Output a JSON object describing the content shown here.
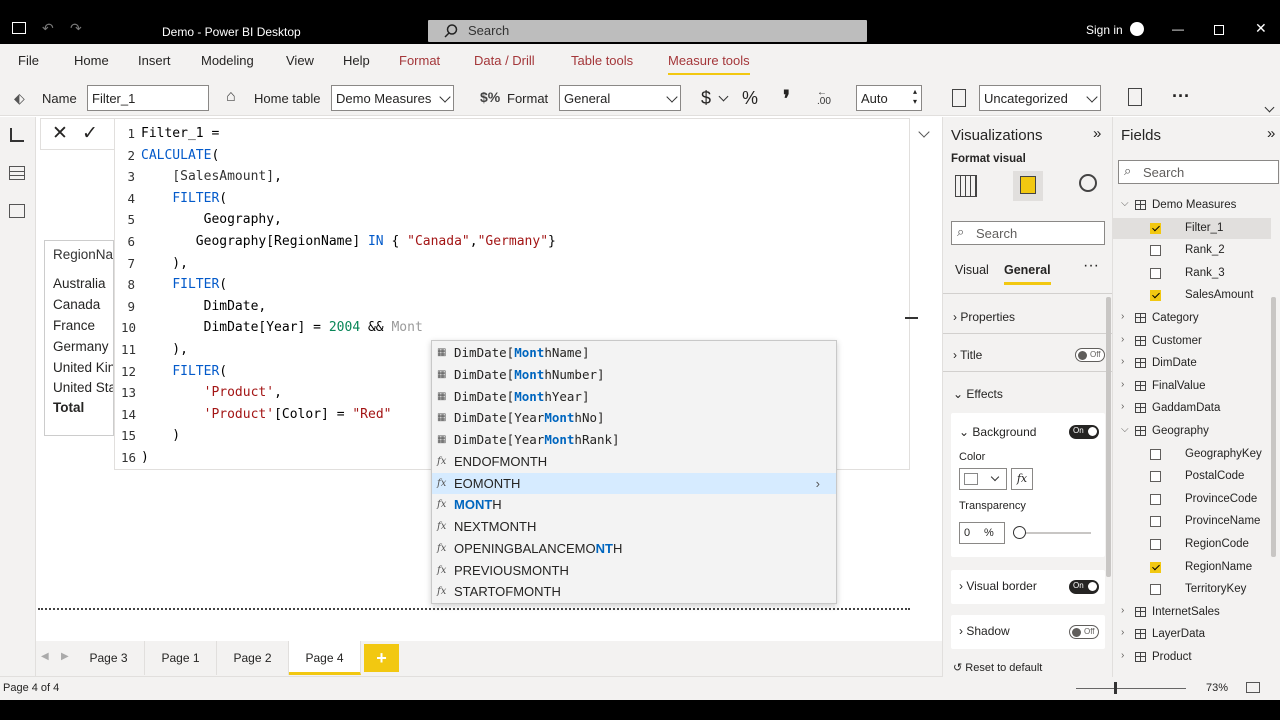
{
  "window": {
    "title": "Demo - Power BI Desktop",
    "search_placeholder": "Search",
    "sign_in": "Sign in"
  },
  "menu": [
    "File",
    "Home",
    "Insert",
    "Modeling",
    "View",
    "Help",
    "Format",
    "Data / Drill",
    "Table tools",
    "Measure tools"
  ],
  "toolbar": {
    "name_label": "Name",
    "name_value": "Filter_1",
    "home_table_label": "Home table",
    "home_table_value": "Demo Measures",
    "format_label": "Format",
    "format_value": "General",
    "currency": "$",
    "percent": "%",
    "comma": "❜",
    "decimals_value": "Auto",
    "category_value": "Uncategorized",
    "more": "···"
  },
  "editor": {
    "lines": [
      {
        "n": "1",
        "html": "Filter_1 ="
      },
      {
        "n": "2",
        "html": "<span class='k'>CALCULATE</span>("
      },
      {
        "n": "3",
        "html": "    <span class='fld'>[SalesAmount]</span>,"
      },
      {
        "n": "4",
        "html": "    <span class='k'>FILTER</span>("
      },
      {
        "n": "5",
        "html": "        Geography,"
      },
      {
        "n": "6",
        "html": "       Geography[RegionName] <span class='k'>IN</span> { <span class='s'>\"Canada\"</span>,<span class='s'>\"Germany\"</span>}"
      },
      {
        "n": "7",
        "html": "    ),"
      },
      {
        "n": "8",
        "html": "    <span class='k'>FILTER</span>("
      },
      {
        "n": "9",
        "html": "        DimDate,"
      },
      {
        "n": "10",
        "html": "        DimDate[Year] = <span class='n'>2004</span> &amp;&amp;<span class='g'> Mont</span>"
      },
      {
        "n": "11",
        "html": "    ),"
      },
      {
        "n": "12",
        "html": "    <span class='k'>FILTER</span>("
      },
      {
        "n": "13",
        "html": "        <span class='s'>'Product'</span>,"
      },
      {
        "n": "14",
        "html": "        <span class='s'>'Product'</span>[Color] = <span class='s'>\"Red\"</span>"
      },
      {
        "n": "15",
        "html": "    )"
      },
      {
        "n": "16",
        "html": ")"
      }
    ]
  },
  "table_visual": {
    "header": "RegionName",
    "rows": [
      "Australia",
      "Canada",
      "France",
      "Germany",
      "United Kingdom",
      "United States"
    ],
    "total": "Total"
  },
  "autocomplete": [
    {
      "type": "column",
      "pre": "DimDate[",
      "hl": "Mont",
      "post": "hName]"
    },
    {
      "type": "column",
      "pre": "DimDate[",
      "hl": "Mont",
      "post": "hNumber]"
    },
    {
      "type": "column",
      "pre": "DimDate[",
      "hl": "Mont",
      "post": "hYear]"
    },
    {
      "type": "column",
      "pre": "DimDate[Year",
      "hl": "Mont",
      "post": "hNo]"
    },
    {
      "type": "column",
      "pre": "DimDate[Year",
      "hl": "Mont",
      "post": "hRank]"
    },
    {
      "type": "function",
      "pre": "ENDOFMONTH",
      "hl": "",
      "post": ""
    },
    {
      "type": "function",
      "pre": "EOMONTH",
      "hl": "",
      "post": "",
      "selected": true
    },
    {
      "type": "function",
      "pre": "",
      "hl": "MONT",
      "post": "H"
    },
    {
      "type": "function",
      "pre": "NEXTMONTH",
      "hl": "",
      "post": ""
    },
    {
      "type": "function",
      "pre": "OPENINGBALANCEMO",
      "hl": "NT",
      "post": "H"
    },
    {
      "type": "function",
      "pre": "PREVIOUSMONTH",
      "hl": "",
      "post": ""
    },
    {
      "type": "function",
      "pre": "STARTOFMONTH",
      "hl": "",
      "post": ""
    }
  ],
  "pages": [
    "Page 3",
    "Page 1",
    "Page 2",
    "Page 4"
  ],
  "active_page": "Page 4",
  "status": {
    "page_info": "Page 4 of 4",
    "zoom": "73%"
  },
  "visualizations": {
    "title": "Visualizations",
    "format_visual": "Format visual",
    "search": "Search",
    "tab_visual": "Visual",
    "tab_general": "General",
    "properties": "Properties",
    "title_section": "Title",
    "title_toggle": "Off",
    "effects": "Effects",
    "background": "Background",
    "background_toggle": "On",
    "color_label": "Color",
    "transparency_label": "Transparency",
    "transparency_value": "0",
    "transparency_unit": "%",
    "visual_border": "Visual border",
    "visual_border_toggle": "On",
    "shadow": "Shadow",
    "shadow_toggle": "Off",
    "reset": "Reset to default"
  },
  "fields": {
    "title": "Fields",
    "search": "Search",
    "items": [
      {
        "label": "Demo Measures",
        "kind": "table",
        "expanded": true,
        "level": 0
      },
      {
        "label": "Filter_1",
        "kind": "measure",
        "checked": true,
        "level": 1,
        "selected": true
      },
      {
        "label": "Rank_2",
        "kind": "measure",
        "checked": false,
        "level": 1
      },
      {
        "label": "Rank_3",
        "kind": "measure",
        "checked": false,
        "level": 1
      },
      {
        "label": "SalesAmount",
        "kind": "measure",
        "checked": true,
        "level": 1
      },
      {
        "label": "Category",
        "kind": "table",
        "level": 0
      },
      {
        "label": "Customer",
        "kind": "table",
        "level": 0
      },
      {
        "label": "DimDate",
        "kind": "table",
        "level": 0
      },
      {
        "label": "FinalValue",
        "kind": "table",
        "level": 0
      },
      {
        "label": "GaddamData",
        "kind": "table",
        "level": 0
      },
      {
        "label": "Geography",
        "kind": "table",
        "expanded": true,
        "level": 0
      },
      {
        "label": "GeographyKey",
        "kind": "field",
        "checked": false,
        "level": 1
      },
      {
        "label": "PostalCode",
        "kind": "field",
        "checked": false,
        "level": 1
      },
      {
        "label": "ProvinceCode",
        "kind": "field",
        "checked": false,
        "level": 1
      },
      {
        "label": "ProvinceName",
        "kind": "field",
        "checked": false,
        "level": 1
      },
      {
        "label": "RegionCode",
        "kind": "field",
        "checked": false,
        "level": 1
      },
      {
        "label": "RegionName",
        "kind": "field",
        "checked": true,
        "level": 1
      },
      {
        "label": "TerritoryKey",
        "kind": "field",
        "checked": false,
        "level": 1
      },
      {
        "label": "InternetSales",
        "kind": "table",
        "level": 0
      },
      {
        "label": "LayerData",
        "kind": "table",
        "level": 0
      },
      {
        "label": "Product",
        "kind": "table",
        "level": 0
      }
    ]
  },
  "colors": {
    "accent": "#f2c811",
    "brand": "#a4373a",
    "keyword": "#035aca",
    "string": "#a31515",
    "number": "#098658"
  }
}
